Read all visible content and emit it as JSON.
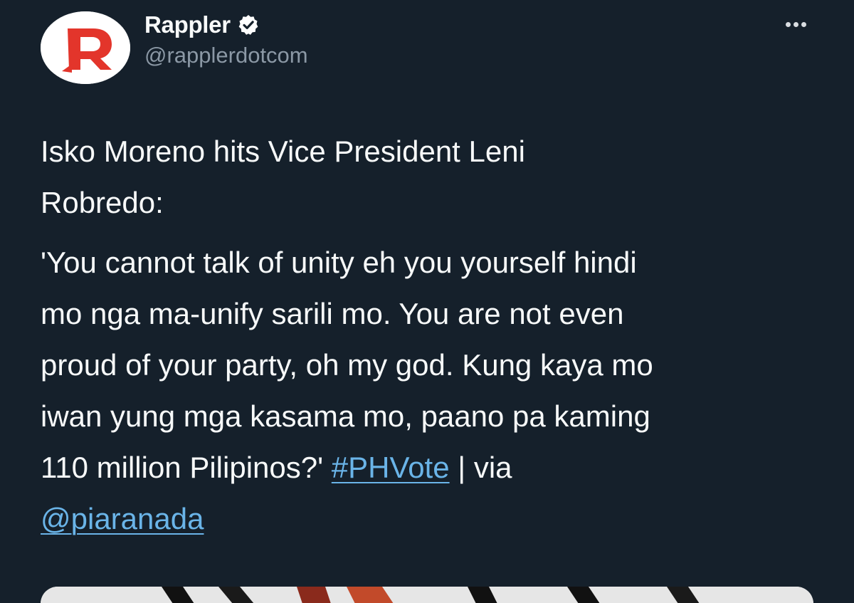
{
  "author": {
    "display_name": "Rappler",
    "handle": "@rapplerdotcom",
    "avatar_icon": "rappler-logo",
    "verified_icon": "verified-badge-icon"
  },
  "menu": {
    "icon": "more-options-icon"
  },
  "tweet": {
    "lines": [
      "Isko Moreno hits Vice President Leni",
      "Robredo:"
    ],
    "quote_lines": [
      "'You cannot talk of unity eh you yourself hindi",
      "mo nga ma-unify sarili mo. You are not even",
      "proud of your party, oh my god. Kung kaya mo",
      "iwan yung mga kasama mo, paano pa kaming"
    ],
    "last_line_text": "110 million Pilipinos?' ",
    "hashtag": "#PHVote",
    "via_text": " | via",
    "mention": "@piaranada"
  },
  "colors": {
    "background": "#15202b",
    "text": "#f7f9f9",
    "secondary": "#8b98a5",
    "link": "#6ab4e8",
    "brand": "#e3352b"
  }
}
